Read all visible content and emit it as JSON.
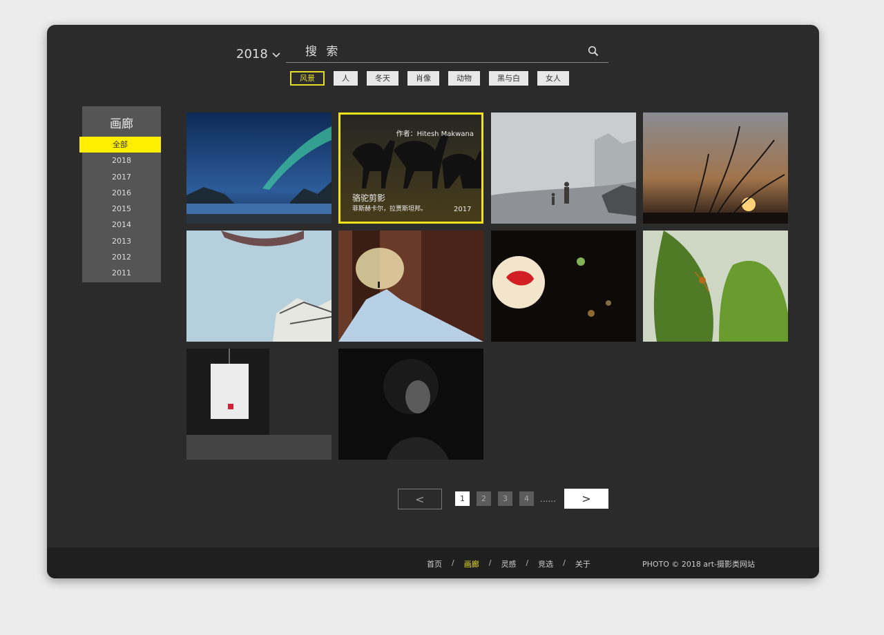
{
  "header": {
    "year": "2018",
    "search_placeholder": "搜 索",
    "tags": [
      {
        "label": "风景",
        "active": true
      },
      {
        "label": "人"
      },
      {
        "label": "冬天"
      },
      {
        "label": "肖像"
      },
      {
        "label": "动物"
      },
      {
        "label": "黑与白"
      },
      {
        "label": "女人"
      }
    ]
  },
  "sidebar": {
    "title": "画廊",
    "items": [
      "全部",
      "2018",
      "2017",
      "2016",
      "2015",
      "2014",
      "2013",
      "2012",
      "2011"
    ]
  },
  "gallery": {
    "featured": {
      "author": "作者：Hitesh Makwana",
      "title": "骆驼剪影",
      "location": "菲斯赫卡尔，拉贾斯坦邦。",
      "year": "2017"
    }
  },
  "pagination": {
    "prev": "<",
    "next": ">",
    "pages": [
      "1",
      "2",
      "3",
      "4"
    ],
    "ellipsis": "......"
  },
  "footer": {
    "nav": [
      "首页",
      "画廊",
      "灵感",
      "竞选",
      "关于"
    ],
    "active_nav": "画廊",
    "copyright": "PHOTO © 2018 art-摄影类网站"
  },
  "colors": {
    "accent": "#ffee00",
    "background": "#2b2b2b",
    "footer": "#1f1f1f"
  }
}
